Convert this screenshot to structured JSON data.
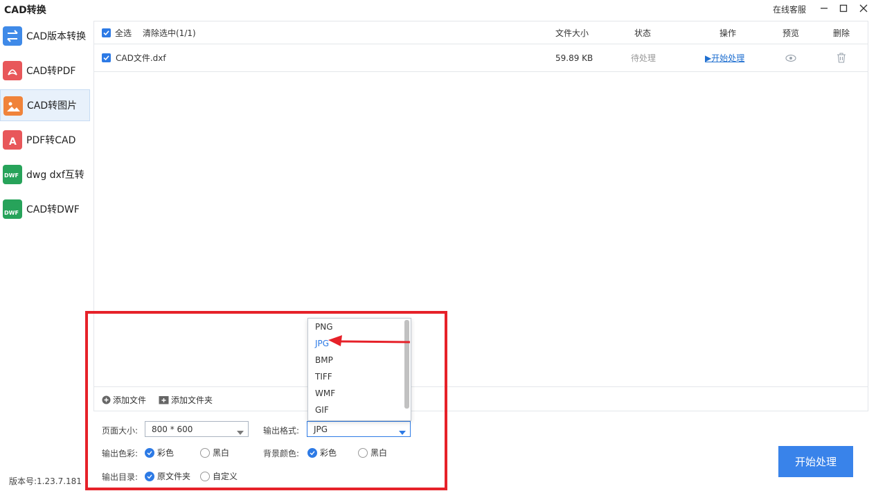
{
  "app": {
    "title": "CAD转换",
    "support": "在线客服",
    "version": "版本号:1.23.7.181"
  },
  "sidebar": {
    "items": [
      {
        "label": "CAD版本转换",
        "icon": "swap-icon",
        "color": "#3f8ae8"
      },
      {
        "label": "CAD转PDF",
        "icon": "pdf-icon",
        "color": "#e8575a"
      },
      {
        "label": "CAD转图片",
        "icon": "image-icon",
        "color": "#f0833a"
      },
      {
        "label": "PDF转CAD",
        "icon": "pdf-to-cad-icon",
        "color": "#e8575a"
      },
      {
        "label": "dwg dxf互转",
        "icon": "dwf-convert-icon",
        "color": "#27a35a"
      },
      {
        "label": "CAD转DWF",
        "icon": "dwf-icon",
        "color": "#27a35a"
      }
    ],
    "active_index": 2
  },
  "table": {
    "select_all": "全选",
    "clear_selected": "清除选中(1/1)",
    "columns": {
      "size": "文件大小",
      "status": "状态",
      "action": "操作",
      "preview": "预览",
      "delete": "删除"
    },
    "rows": [
      {
        "name": "CAD文件.dxf",
        "size": "59.89 KB",
        "status": "待处理",
        "action": "▶开始处理"
      }
    ]
  },
  "actions": {
    "add_file": "添加文件",
    "add_folder": "添加文件夹"
  },
  "settings": {
    "page_size_label": "页面大小:",
    "page_size_value": "800 * 600",
    "output_format_label": "输出格式:",
    "output_format_value": "JPG",
    "output_color_label": "输出色彩:",
    "color_option": "彩色",
    "bw_option": "黑白",
    "background_label": "背景颜色:",
    "output_dir_label": "输出目录:",
    "dir_original": "原文件夹",
    "dir_custom": "自定义"
  },
  "format_dropdown": {
    "options": [
      "PNG",
      "JPG",
      "BMP",
      "TIFF",
      "WMF",
      "GIF"
    ],
    "selected": "JPG"
  },
  "start_button": "开始处理",
  "colors": {
    "accent": "#2d7ae5",
    "button": "#3983ea",
    "highlight": "#e62129"
  }
}
